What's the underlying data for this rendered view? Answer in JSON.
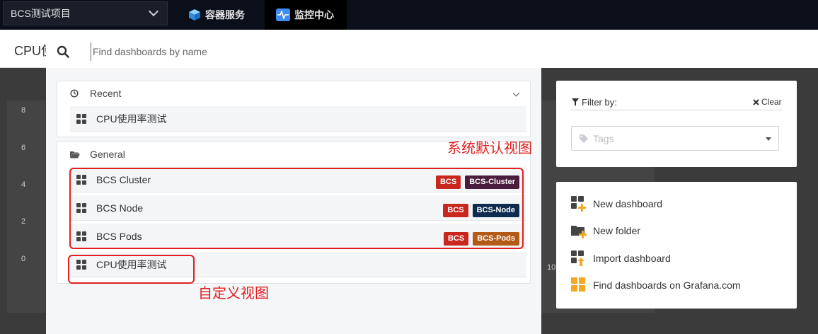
{
  "topnav": {
    "project_select": "BCS测试项目",
    "tabs": [
      {
        "label": "容器服务",
        "icon": "cube-icon"
      },
      {
        "label": "监控中心",
        "icon": "pulse-icon"
      }
    ]
  },
  "page": {
    "title": "CPU使用率测试",
    "y_ticks": [
      "8",
      "6",
      "4",
      "2",
      "0"
    ],
    "x_tick": "10"
  },
  "search": {
    "placeholder": "Find dashboards by name"
  },
  "sections": {
    "recent": {
      "label": "Recent",
      "items": [
        {
          "title": "CPU使用率测试"
        }
      ]
    },
    "general": {
      "label": "General",
      "items": [
        {
          "title": "BCS Cluster",
          "tags": [
            {
              "label": "BCS",
              "color": "#c9261e"
            },
            {
              "label": "BCS-Cluster",
              "color": "#4a1d3f"
            }
          ]
        },
        {
          "title": "BCS Node",
          "tags": [
            {
              "label": "BCS",
              "color": "#c9261e"
            },
            {
              "label": "BCS-Node",
              "color": "#0e2c4f"
            }
          ]
        },
        {
          "title": "BCS Pods",
          "tags": [
            {
              "label": "BCS",
              "color": "#c9261e"
            },
            {
              "label": "BCS-Pods",
              "color": "#b35a17"
            }
          ]
        },
        {
          "title": "CPU使用率测试",
          "tags": []
        }
      ]
    }
  },
  "annotations": {
    "system_default": "系统默认视图",
    "custom": "自定义视图"
  },
  "filter": {
    "label": "Filter by:",
    "clear": "Clear",
    "tags_placeholder": "Tags"
  },
  "actions": [
    {
      "label": "New dashboard",
      "icon": "new-dashboard-icon"
    },
    {
      "label": "New folder",
      "icon": "new-folder-icon"
    },
    {
      "label": "Import dashboard",
      "icon": "import-dashboard-icon"
    },
    {
      "label": "Find dashboards on Grafana.com",
      "icon": "grafana-com-icon"
    }
  ],
  "colors": {
    "annotation_red": "#e02020",
    "grafana_orange": "#f5a623",
    "accent_blue": "#3e8df0"
  }
}
